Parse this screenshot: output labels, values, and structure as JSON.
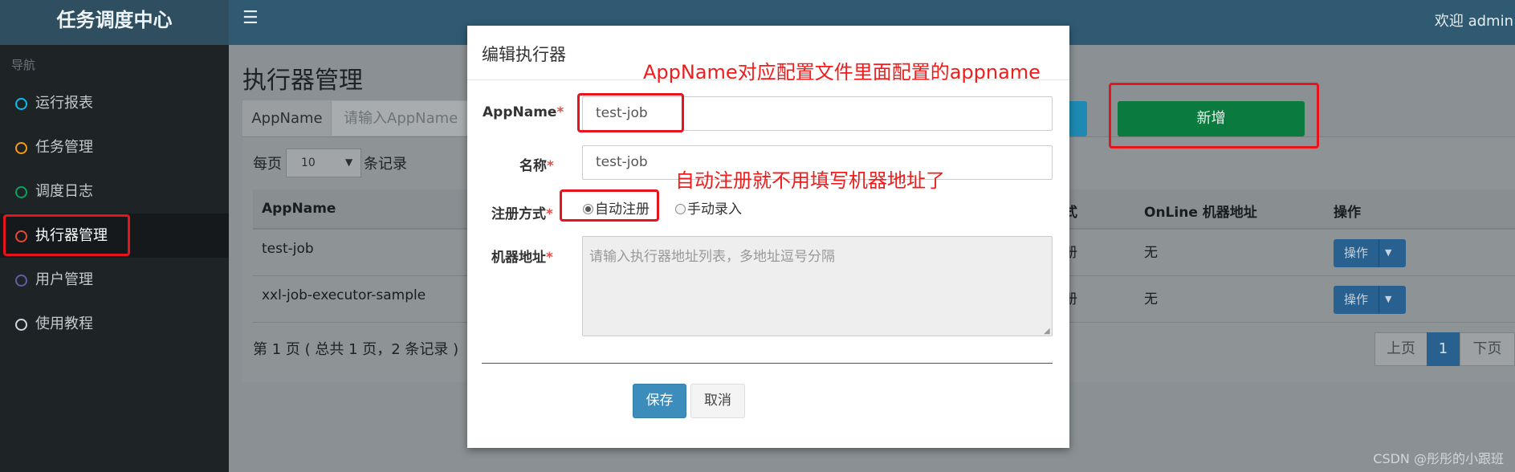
{
  "app": {
    "title": "任务调度中心",
    "welcome": "欢迎 admin"
  },
  "sidebar": {
    "header": "导航",
    "items": [
      {
        "label": "运行报表",
        "color": "#00c0ef"
      },
      {
        "label": "任务管理",
        "color": "#f39c12"
      },
      {
        "label": "调度日志",
        "color": "#00a65a"
      },
      {
        "label": "执行器管理",
        "color": "#dd4b39"
      },
      {
        "label": "用户管理",
        "color": "#605ca8"
      },
      {
        "label": "使用教程",
        "color": "#d2d6de"
      }
    ]
  },
  "page": {
    "title": "执行器管理",
    "search": {
      "addon": "AppName",
      "placeholder": "请输入AppName"
    },
    "add_label": "新增",
    "page_size_prefix": "每页",
    "page_size_value": "10",
    "page_size_suffix": "条记录",
    "columns": [
      "AppName",
      "式",
      "OnLine 机器地址",
      "操作"
    ],
    "rows": [
      {
        "appname": "test-job",
        "type": "册",
        "online": "无",
        "op": "操作"
      },
      {
        "appname": "xxl-job-executor-sample",
        "type": "册",
        "online": "无",
        "op": "操作"
      }
    ],
    "page_info": "第 1 页 ( 总共 1 页，2 条记录 )",
    "pager": {
      "prev": "上页",
      "current": "1",
      "next": "下页"
    }
  },
  "modal": {
    "title": "编辑执行器",
    "appname_label": "AppName",
    "appname_value": "test-job",
    "name_label": "名称",
    "name_value": "test-job",
    "reg_label": "注册方式",
    "reg_auto": "自动注册",
    "reg_manual": "手动录入",
    "addr_label": "机器地址",
    "addr_placeholder": "请输入执行器地址列表，多地址逗号分隔",
    "required_mark": "*",
    "save": "保存",
    "cancel": "取消"
  },
  "annotations": {
    "appname_note": "AppName对应配置文件里面配置的appname",
    "auto_note": "自动注册就不用填写机器地址了"
  },
  "watermark": "CSDN @彤彤的小跟班"
}
